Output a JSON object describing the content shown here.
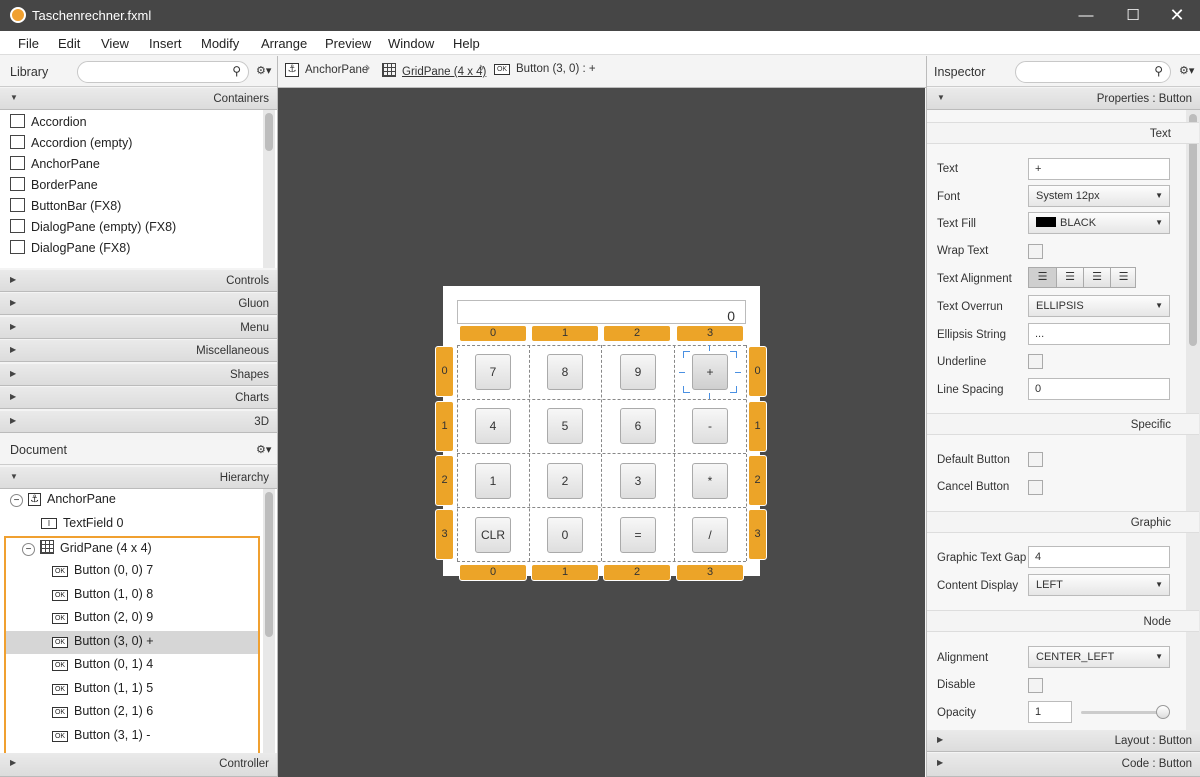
{
  "window": {
    "title": "Taschenrechner.fxml"
  },
  "menu": [
    "File",
    "Edit",
    "View",
    "Insert",
    "Modify",
    "Arrange",
    "Preview",
    "Window",
    "Help"
  ],
  "library": {
    "title": "Library",
    "sections": {
      "containers": "Containers",
      "others": [
        "Controls",
        "Gluon",
        "Menu",
        "Miscellaneous",
        "Shapes",
        "Charts",
        "3D"
      ]
    },
    "items": [
      "Accordion",
      "Accordion  (empty)",
      "AnchorPane",
      "BorderPane",
      "ButtonBar  (FX8)",
      "DialogPane (empty)  (FX8)",
      "DialogPane  (FX8)"
    ]
  },
  "document": {
    "title": "Document",
    "hierarchy_label": "Hierarchy",
    "controller_label": "Controller",
    "tree": [
      {
        "label": "AnchorPane",
        "level": 0
      },
      {
        "label": "TextField  0",
        "level": 1
      },
      {
        "label": "GridPane (4 x 4)",
        "level": 1
      },
      {
        "label": "Button (0, 0)  7",
        "level": 2
      },
      {
        "label": "Button (1, 0)  8",
        "level": 2
      },
      {
        "label": "Button (2, 0)  9",
        "level": 2
      },
      {
        "label": "Button (3, 0)  +",
        "level": 2
      },
      {
        "label": "Button (0, 1)  4",
        "level": 2
      },
      {
        "label": "Button (1, 1)  5",
        "level": 2
      },
      {
        "label": "Button (2, 1)  6",
        "level": 2
      },
      {
        "label": "Button (3, 1)  -",
        "level": 2
      }
    ]
  },
  "breadcrumb": [
    "AnchorPane",
    "GridPane (4 x 4)",
    "Button (3, 0) : +"
  ],
  "calculator": {
    "display": "0",
    "col_labels": [
      "0",
      "1",
      "2",
      "3"
    ],
    "row_labels": [
      "0",
      "1",
      "2",
      "3"
    ],
    "buttons": [
      [
        "7",
        "8",
        "9",
        "+"
      ],
      [
        "4",
        "5",
        "6",
        "-"
      ],
      [
        "1",
        "2",
        "3",
        "*"
      ],
      [
        "CLR",
        "0",
        "=",
        "/"
      ]
    ]
  },
  "inspector": {
    "title": "Inspector",
    "properties_label": "Properties : Button",
    "text_section": "Text",
    "specific_section": "Specific",
    "graphic_section": "Graphic",
    "node_section": "Node",
    "layout_label": "Layout : Button",
    "code_label": "Code : Button",
    "props": {
      "text": {
        "label": "Text",
        "value": "+"
      },
      "font": {
        "label": "Font",
        "value": "System 12px"
      },
      "text_fill": {
        "label": "Text Fill",
        "value": "BLACK"
      },
      "wrap_text": {
        "label": "Wrap Text"
      },
      "text_alignment": {
        "label": "Text Alignment"
      },
      "text_overrun": {
        "label": "Text Overrun",
        "value": "ELLIPSIS"
      },
      "ellipsis_string": {
        "label": "Ellipsis String",
        "value": "..."
      },
      "underline": {
        "label": "Underline"
      },
      "line_spacing": {
        "label": "Line Spacing",
        "value": "0"
      },
      "default_button": {
        "label": "Default Button"
      },
      "cancel_button": {
        "label": "Cancel Button"
      },
      "graphic_text_gap": {
        "label": "Graphic Text Gap",
        "value": "4"
      },
      "content_display": {
        "label": "Content Display",
        "value": "LEFT"
      },
      "alignment": {
        "label": "Alignment",
        "value": "CENTER_LEFT"
      },
      "disable": {
        "label": "Disable"
      },
      "opacity": {
        "label": "Opacity",
        "value": "1"
      }
    }
  },
  "colors": {
    "accent": "#eca428",
    "canvas": "#4a4a4a",
    "titlebar": "#464646",
    "selection_outline": "#f0a030"
  }
}
